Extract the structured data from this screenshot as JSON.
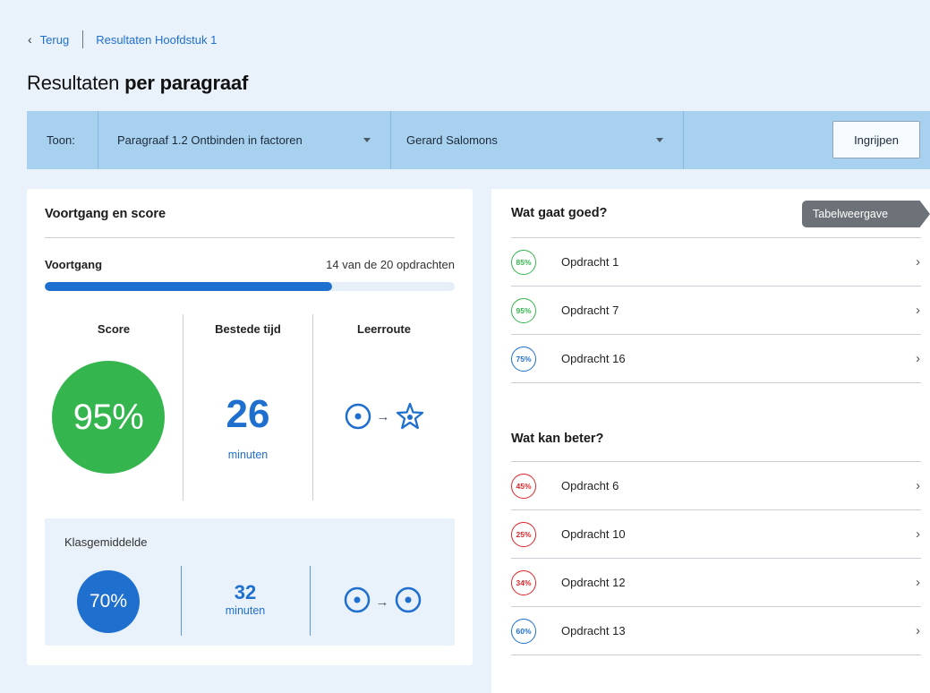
{
  "breadcrumb": {
    "back_label": "Terug",
    "current": "Resultaten Hoofdstuk 1"
  },
  "title": {
    "normal": "Resultaten ",
    "bold": "per paragraaf"
  },
  "filter": {
    "toon_label": "Toon:",
    "paragraph": "Paragraaf 1.2 Ontbinden in factoren",
    "student": "Gerard Salomons",
    "action_button": "Ingrijpen"
  },
  "left": {
    "header": "Voortgang en score",
    "progress": {
      "label": "Voortgang",
      "count_text": "14 van de 20 opdrachten",
      "done": 14,
      "total": 20
    },
    "score": {
      "title": "Score",
      "value": "95%"
    },
    "time": {
      "title": "Bestede tijd",
      "value": "26",
      "unit": "minuten"
    },
    "route": {
      "title": "Leerroute",
      "icons": [
        "target-icon",
        "arrow-right-icon",
        "star-icon"
      ]
    },
    "class_average": {
      "label": "Klasgemiddelde",
      "score": "70%",
      "time_value": "32",
      "time_unit": "minuten",
      "route_icons": [
        "target-icon",
        "arrow-right-icon",
        "target-icon"
      ]
    }
  },
  "right": {
    "good_header": "Wat gaat goed?",
    "view_toggle": "Tabelweergave",
    "good_items": [
      {
        "badge": "85%",
        "label": "Opdracht 1",
        "status": "good"
      },
      {
        "badge": "95%",
        "label": "Opdracht 7",
        "status": "good"
      },
      {
        "badge": "75%",
        "label": "Opdracht 16",
        "status": "ok"
      }
    ],
    "better_header": "Wat kan beter?",
    "better_items": [
      {
        "badge": "45%",
        "label": "Opdracht 6",
        "status": "bad"
      },
      {
        "badge": "25%",
        "label": "Opdracht 10",
        "status": "bad"
      },
      {
        "badge": "34%",
        "label": "Opdracht 12",
        "status": "bad"
      },
      {
        "badge": "60%",
        "label": "Opdracht 13",
        "status": "ok"
      }
    ]
  },
  "colors": {
    "accent": "#1f6fcf",
    "good": "#34b54e",
    "bad": "#e0252b",
    "filterbar": "#a8d1ef",
    "page_bg": "#e9f1fa"
  }
}
